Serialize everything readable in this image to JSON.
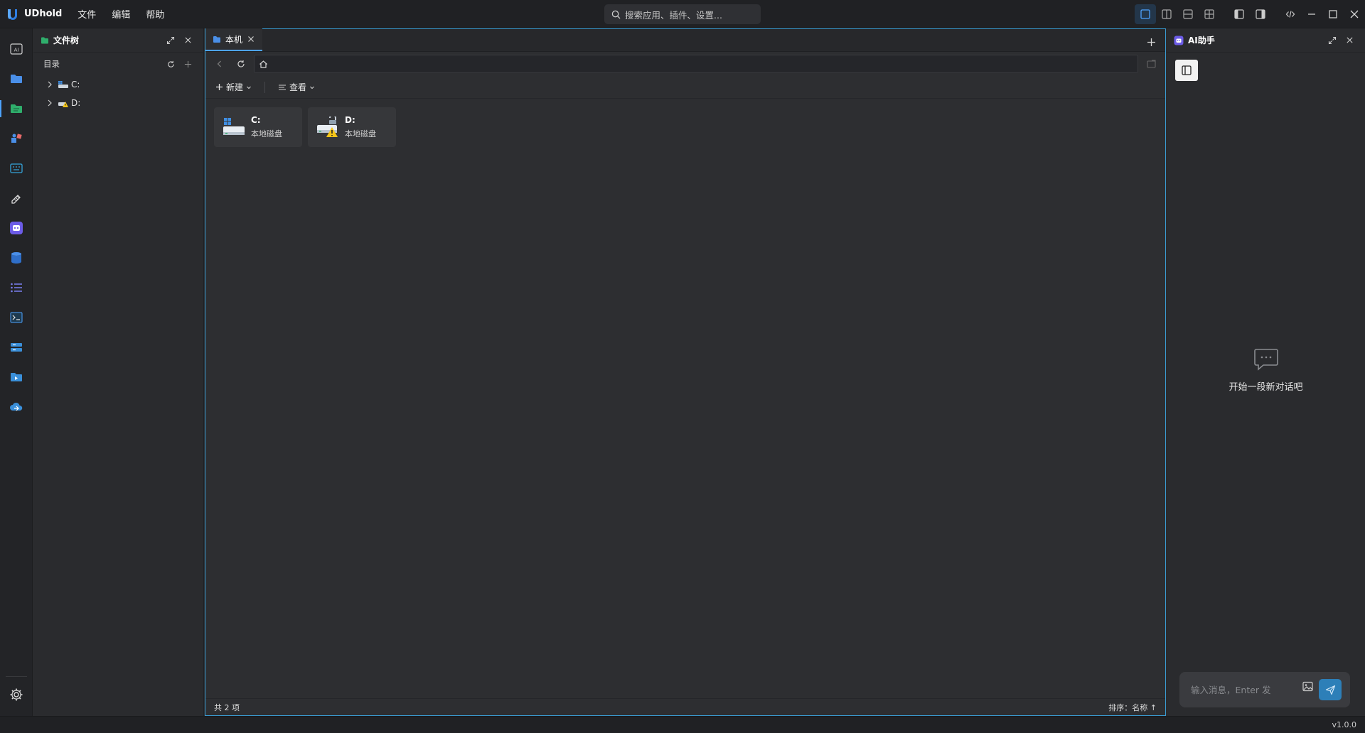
{
  "app": {
    "name": "UDhold",
    "version": "v1.0.0"
  },
  "menu": [
    {
      "label": "文件"
    },
    {
      "label": "编辑"
    },
    {
      "label": "帮助"
    }
  ],
  "search": {
    "placeholder": "搜索应用、插件、设置..."
  },
  "activity": [
    {
      "name": "ai"
    },
    {
      "name": "folder"
    },
    {
      "name": "file-tree",
      "active": true
    },
    {
      "name": "plugins"
    },
    {
      "name": "keyboard"
    },
    {
      "name": "tools"
    },
    {
      "name": "bot"
    },
    {
      "name": "database"
    },
    {
      "name": "list"
    },
    {
      "name": "terminal"
    },
    {
      "name": "server"
    },
    {
      "name": "video-folder"
    },
    {
      "name": "cloud"
    }
  ],
  "sidebar": {
    "title": "文件树",
    "section": "目录",
    "items": [
      {
        "label": "C:"
      },
      {
        "label": "D:"
      }
    ]
  },
  "main": {
    "tab": {
      "label": "本机"
    },
    "toolbar": {
      "new_label": "新建",
      "view_label": "查看"
    },
    "drives": [
      {
        "name": "C:",
        "desc": "本地磁盘"
      },
      {
        "name": "D:",
        "desc": "本地磁盘"
      }
    ],
    "status": {
      "count": "共 2 项",
      "sort": "排序：名称 ↑"
    }
  },
  "ai": {
    "title": "AI助手",
    "empty_text": "开始一段新对话吧",
    "input_placeholder": "输入消息，Enter 发"
  },
  "colors": {
    "accent": "#4da3ff",
    "border_focus": "#3a9bd1",
    "send": "#2d7fb8",
    "ai_purple": "#6c5ce7"
  }
}
